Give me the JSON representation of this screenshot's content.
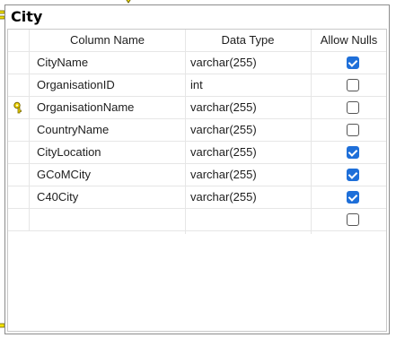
{
  "table": {
    "title": "City",
    "headers": {
      "column_name": "Column Name",
      "data_type": "Data Type",
      "allow_nulls": "Allow Nulls"
    },
    "rows": [
      {
        "name": "CityName",
        "type": "varchar(255)",
        "nulls": true,
        "key": false
      },
      {
        "name": "OrganisationID",
        "type": "int",
        "nulls": false,
        "key": false
      },
      {
        "name": "OrganisationName",
        "type": "varchar(255)",
        "nulls": false,
        "key": true
      },
      {
        "name": "CountryName",
        "type": "varchar(255)",
        "nulls": false,
        "key": false
      },
      {
        "name": "CityLocation",
        "type": "varchar(255)",
        "nulls": true,
        "key": false
      },
      {
        "name": "GCoMCity",
        "type": "varchar(255)",
        "nulls": true,
        "key": false
      },
      {
        "name": "C40City",
        "type": "varchar(255)",
        "nulls": true,
        "key": false
      },
      {
        "name": "",
        "type": "",
        "nulls": false,
        "key": false
      }
    ]
  },
  "colors": {
    "checkbox_checked": "#1e6fd9",
    "key_icon": "#e6c800",
    "border": "#8c8c8c"
  },
  "icons": {
    "primary_key": "key-icon",
    "relationship": "relationship-connector-icon"
  }
}
